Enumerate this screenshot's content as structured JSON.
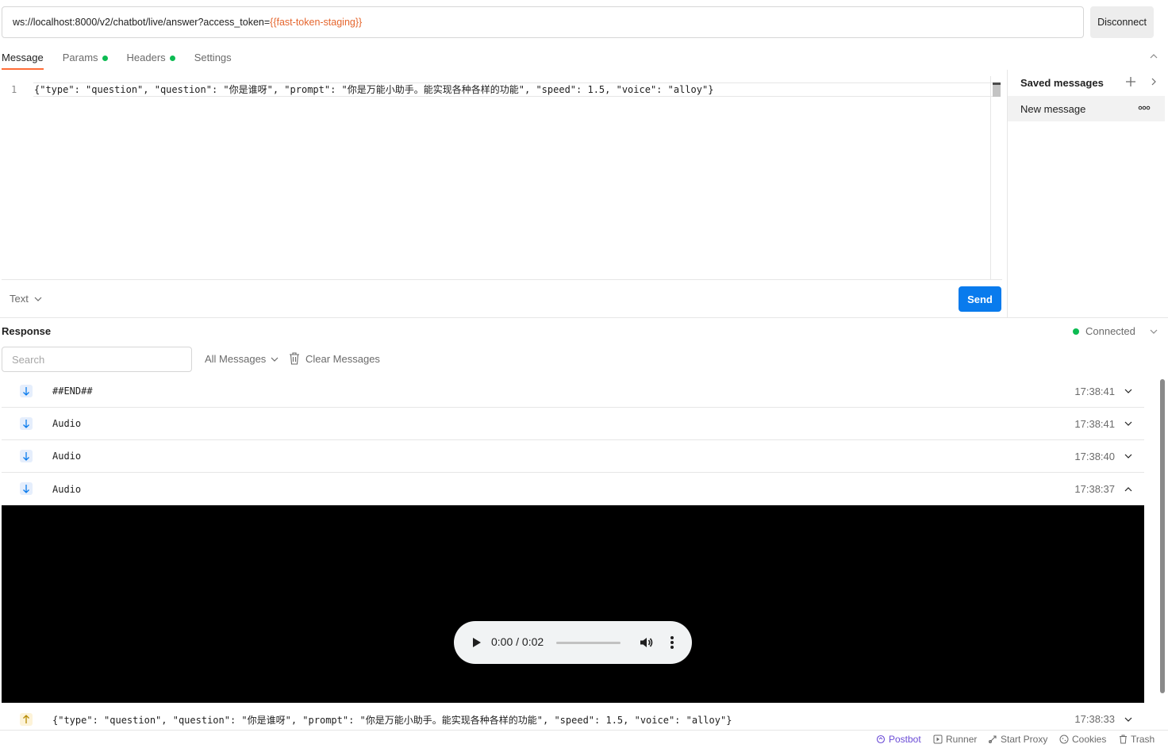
{
  "request": {
    "url_prefix": "ws://localhost:8000/v2/chatbot/live/answer?access_token=",
    "url_variable": "{{fast-token-staging}}",
    "disconnect_label": "Disconnect"
  },
  "tabs": [
    {
      "label": "Message",
      "active": true
    },
    {
      "label": "Params",
      "dot": true
    },
    {
      "label": "Headers",
      "dot": true
    },
    {
      "label": "Settings"
    }
  ],
  "editor": {
    "line_number": "1",
    "code": "{\"type\": \"question\", \"question\": \"你是谁呀\", \"prompt\": \"你是万能小助手。能实现各种各样的功能\", \"speed\": 1.5, \"voice\": \"alloy\"}",
    "format_label": "Text",
    "send_label": "Send"
  },
  "saved": {
    "title": "Saved messages",
    "items": [
      "New message"
    ]
  },
  "response": {
    "title": "Response",
    "status": "Connected",
    "search_placeholder": "Search",
    "filter_label": "All Messages",
    "clear_label": "Clear Messages",
    "messages": [
      {
        "direction": "in",
        "text": "##END##",
        "time": "17:38:41",
        "expanded": false
      },
      {
        "direction": "in",
        "text": "Audio",
        "time": "17:38:41",
        "expanded": false
      },
      {
        "direction": "in",
        "text": "Audio",
        "time": "17:38:40",
        "expanded": false
      },
      {
        "direction": "in",
        "text": "Audio",
        "time": "17:38:37",
        "expanded": true
      },
      {
        "direction": "out",
        "text": "{\"type\": \"question\", \"question\": \"你是谁呀\", \"prompt\": \"你是万能小助手。能实现各种各样的功能\", \"speed\": 1.5, \"voice\": \"alloy\"}",
        "time": "17:38:33",
        "expanded": false
      }
    ],
    "player": {
      "time": "0:00 / 0:02"
    }
  },
  "footer": {
    "postbot": "Postbot",
    "runner": "Runner",
    "start_proxy": "Start Proxy",
    "cookies": "Cookies",
    "trash": "Trash"
  },
  "colors": {
    "accent": "#ff6c37",
    "send": "#097bed",
    "connected": "#0cbb52",
    "variable": "#e5662e",
    "postbot": "#6b4cd6"
  },
  "icons": {
    "collapse": "chevron-up-icon",
    "saved_add": "plus-icon",
    "saved_expand": "chevron-right-icon",
    "more": "more-horizontal-icon",
    "incoming": "arrow-down-icon",
    "outgoing": "arrow-up-icon",
    "clear": "trash-icon"
  }
}
